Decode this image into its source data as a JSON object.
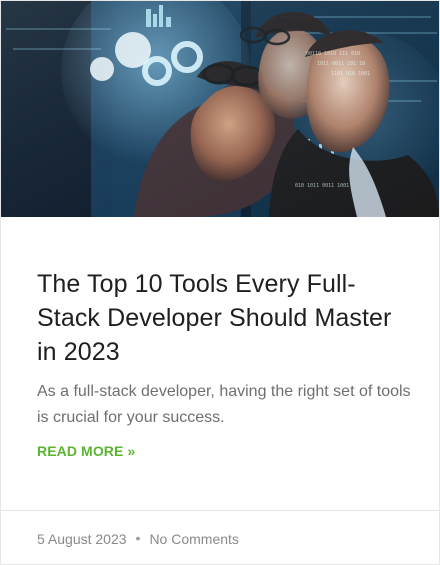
{
  "post": {
    "title": "The Top 10 Tools Every Full-Stack Developer Should Master in 2023",
    "excerpt": "As a full-stack developer, having the right set of tools is crucial for your success.",
    "read_more": "READ MORE »",
    "date": "5 August 2023",
    "separator": "•",
    "comments": "No Comments"
  },
  "colors": {
    "title": "#1f1f1f",
    "excerpt": "#6f6f6f",
    "read_more": "#5bb531",
    "meta": "#8a8a8a",
    "divider": "#e7e7e7"
  },
  "icons": {
    "hero": "developer-team-hologram-image"
  }
}
